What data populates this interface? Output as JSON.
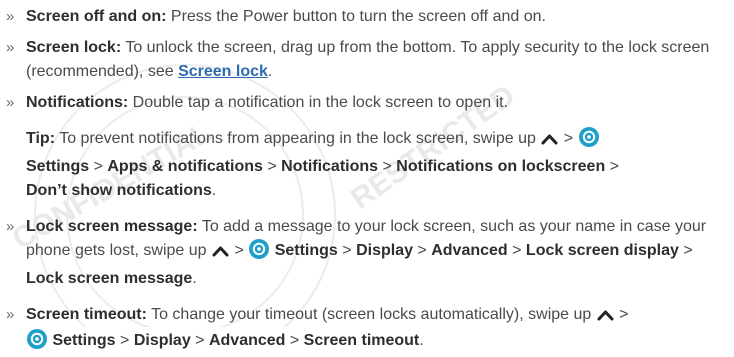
{
  "bullet": "»",
  "items": {
    "screen_off_on": {
      "label": "Screen off and on:",
      "text": " Press the Power button to turn the screen off and on."
    },
    "screen_lock": {
      "label": "Screen lock:",
      "text": " To unlock the screen, drag up from the bottom. To apply security to the lock screen (recommended), see ",
      "link": "Screen lock",
      "end": "."
    },
    "notifications": {
      "label": "Notifications:",
      "text": " Double tap a notification in the lock screen to open it."
    },
    "tip": {
      "label": "Tip:",
      "text": " To prevent notifications from appearing in the lock screen, swipe up ",
      "p1": "Settings",
      "p2": "Apps & notifications",
      "p3": "Notifications",
      "p4": "Notifications on lockscreen",
      "p5": "Don’t show notifications",
      "end": "."
    },
    "lock_message": {
      "label": "Lock screen message:",
      "text": " To add a message to your lock screen, such as your name in case your phone gets lost, swipe up ",
      "p1": "Settings",
      "p2": "Display",
      "p3": "Advanced",
      "p4": "Lock screen display",
      "p5": "Lock screen message",
      "end": "."
    },
    "timeout": {
      "label": "Screen timeout:",
      "text": " To change your timeout (screen locks automatically), swipe up ",
      "p1": "Settings",
      "p2": "Display",
      "p3": "Advanced",
      "p4": "Screen timeout",
      "end": "."
    }
  },
  "separator": " > ",
  "icons": {
    "swipe_up": "chevron-up-icon",
    "settings": "settings-gear-icon"
  },
  "colors": {
    "text": "#4a4a4a",
    "bold": "#2e2e2e",
    "link": "#2e6bb0",
    "gear": "#1ea0c8"
  }
}
